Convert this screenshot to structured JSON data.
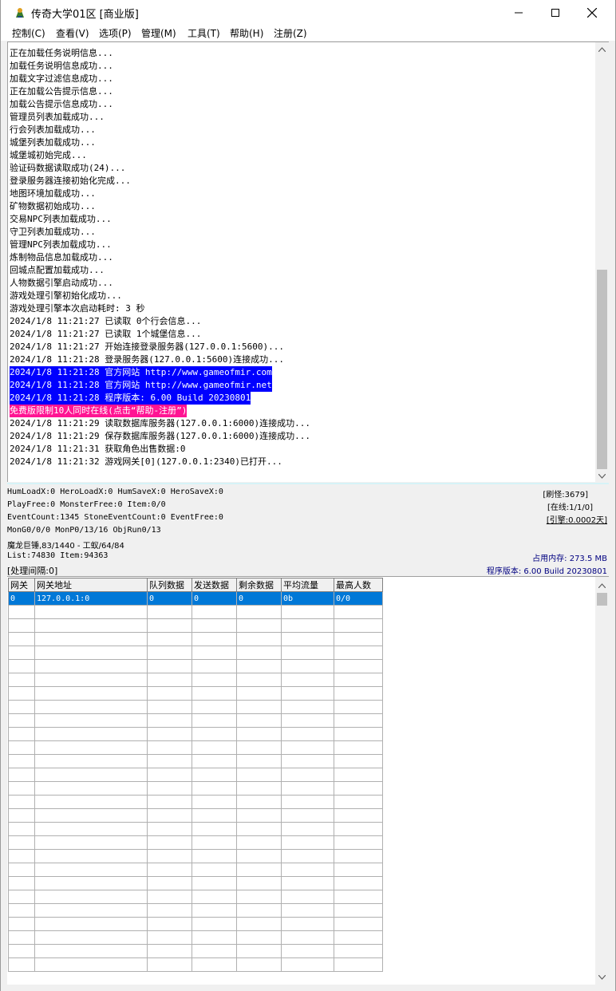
{
  "window": {
    "title": "传奇大学01区 [商业版]",
    "minimize": "—",
    "maximize": "☐",
    "close": "✕"
  },
  "menu": [
    "控制(C)",
    "查看(V)",
    "选项(P)",
    "管理(M)",
    "工具(T)",
    "帮助(H)",
    "注册(Z)"
  ],
  "log": [
    {
      "text": "正在加载任务说明信息...",
      "style": ""
    },
    {
      "text": "加载任务说明信息成功...",
      "style": ""
    },
    {
      "text": "加载文字过滤信息成功...",
      "style": ""
    },
    {
      "text": "正在加载公告提示信息...",
      "style": ""
    },
    {
      "text": "加载公告提示信息成功...",
      "style": ""
    },
    {
      "text": "管理员列表加载成功...",
      "style": ""
    },
    {
      "text": "行会列表加载成功...",
      "style": ""
    },
    {
      "text": "城堡列表加载成功...",
      "style": ""
    },
    {
      "text": "城堡城初始完成...",
      "style": ""
    },
    {
      "text": "验证码数据读取成功(24)...",
      "style": ""
    },
    {
      "text": "登录服务器连接初始化完成...",
      "style": ""
    },
    {
      "text": "地图环境加载成功...",
      "style": ""
    },
    {
      "text": "矿物数据初始成功...",
      "style": ""
    },
    {
      "text": "交易NPC列表加载成功...",
      "style": ""
    },
    {
      "text": "守卫列表加载成功...",
      "style": ""
    },
    {
      "text": "管理NPC列表加载成功...",
      "style": ""
    },
    {
      "text": "炼制物品信息加载成功...",
      "style": ""
    },
    {
      "text": "回城点配置加载成功...",
      "style": ""
    },
    {
      "text": "人物数据引擎启动成功...",
      "style": ""
    },
    {
      "text": "游戏处理引擎初始化成功...",
      "style": ""
    },
    {
      "text": "游戏处理引擎本次启动耗时: 3 秒",
      "style": ""
    },
    {
      "text": "2024/1/8 11:21:27 已读取 0个行会信息...",
      "style": ""
    },
    {
      "text": "2024/1/8 11:21:27 已读取 1个城堡信息...",
      "style": ""
    },
    {
      "text": "2024/1/8 11:21:27 开始连接登录服务器(127.0.0.1:5600)...",
      "style": ""
    },
    {
      "text": "2024/1/8 11:21:28 登录服务器(127.0.0.1:5600)连接成功...",
      "style": ""
    },
    {
      "text": "2024/1/8 11:21:28 官方网站 http://www.gameofmir.com",
      "style": "hl-blue"
    },
    {
      "text": "2024/1/8 11:21:28 官方网站 http://www.gameofmir.net",
      "style": "hl-blue"
    },
    {
      "text": "2024/1/8 11:21:28 程序版本: 6.00 Build 20230801",
      "style": "hl-blue"
    },
    {
      "text": "免费版限制10人同时在线(点击“帮助-注册”)",
      "style": "hl-pink"
    },
    {
      "text": "2024/1/8 11:21:29 读取数据库服务器(127.0.0.1:6000)连接成功...",
      "style": ""
    },
    {
      "text": "2024/1/8 11:21:29 保存数据库服务器(127.0.0.1:6000)连接成功...",
      "style": ""
    },
    {
      "text": "2024/1/8 11:21:31 获取角色出售数据:0",
      "style": ""
    },
    {
      "text": "2024/1/8 11:21:32 游戏网关[0](127.0.0.1:2340)已打开...",
      "style": ""
    }
  ],
  "status": {
    "line1": "HumLoadX:0 HeroLoadX:0 HumSaveX:0 HeroSaveX:0",
    "line2": "PlayFree:0 MonsterFree:0 Item:0/0",
    "line3": "EventCount:1345 StoneEventCount:0 EventFree:0",
    "line4": "MonG0/0/0 MonP0/13/16 ObjRun0/13",
    "line5": "魔龙巨锤,83/1440 - 工蚁/64/84",
    "line6": "List:74830 Item:94363",
    "line7": "[处理间隔:0]",
    "refresh": "[刷怪:3679]",
    "online": "[在线:1/1/0]",
    "engine": "[引擎:0.0002天]",
    "memory": "占用内存: 273.5 MB",
    "version": "程序版本: 6.00 Build 20230801"
  },
  "grid": {
    "headers": [
      "网关",
      "网关地址",
      "队列数据",
      "发送数据",
      "剩余数据",
      "平均流量",
      "最高人数"
    ],
    "rows": [
      [
        "0",
        "127.0.0.1:0",
        "0",
        "0",
        "0",
        "0b",
        "0/0"
      ]
    ]
  }
}
